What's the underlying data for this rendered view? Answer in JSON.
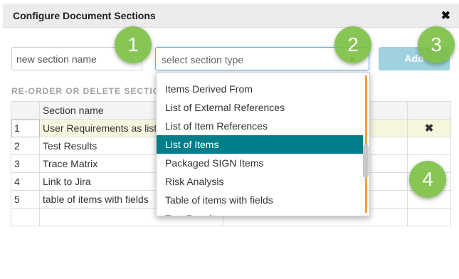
{
  "dialog": {
    "title": "Configure Document Sections",
    "close_label": "✖"
  },
  "form": {
    "name_placeholder": "new section name",
    "type_placeholder": "select section type",
    "add_label": "Add"
  },
  "list_heading": "RE-ORDER OR DELETE SECTIONS",
  "table": {
    "headers": [
      "",
      "Section name",
      "",
      ""
    ],
    "rows": [
      {
        "num": "1",
        "name": "User Requirements as list",
        "delete": "✖"
      },
      {
        "num": "2",
        "name": "Test Results"
      },
      {
        "num": "3",
        "name": "Trace Matrix"
      },
      {
        "num": "4",
        "name": "Link to Jira"
      },
      {
        "num": "5",
        "name": "table of items with fields"
      }
    ]
  },
  "dropdown": {
    "options": [
      "Items Derived From",
      "List of External References",
      "List of Item References",
      "List of Items",
      "Packaged SIGN Items",
      "Risk Analysis",
      "Table of items with fields",
      "Test Results"
    ],
    "selected": "List of Items"
  },
  "markers": [
    "1",
    "2",
    "3",
    "4"
  ],
  "colors": {
    "selected_bg": "#007f8a",
    "marker": "#7abf42",
    "add_button": "#9fd2de"
  }
}
